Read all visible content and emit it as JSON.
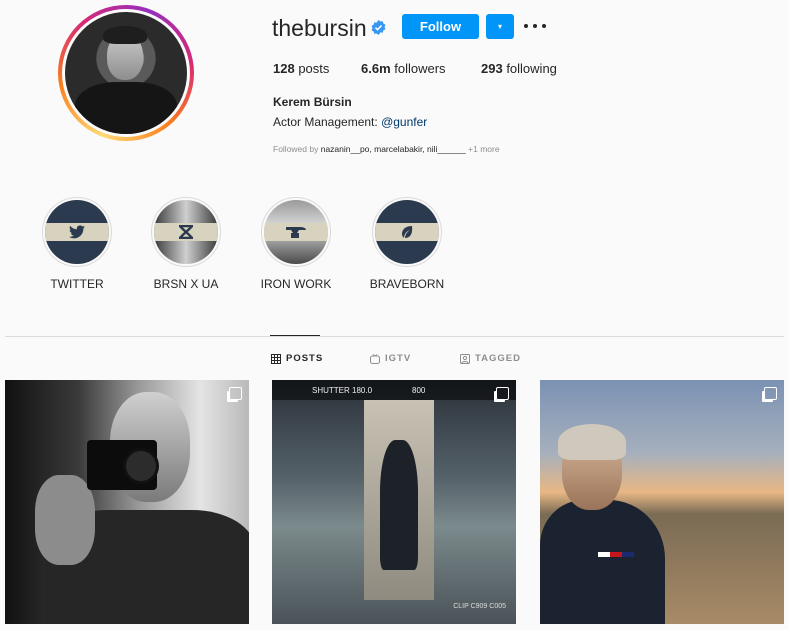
{
  "profile": {
    "username": "thebursin",
    "follow_label": "Follow",
    "dropdown_glyph": "▾",
    "posts_count": "128",
    "posts_label": " posts",
    "followers_count": "6.6m",
    "followers_label": " followers",
    "following_count": "293",
    "following_label": " following",
    "full_name": "Kerem Bürsin",
    "bio_text": "Actor Management: ",
    "bio_link": "@gunfer",
    "followed_by_prefix": "Followed by ",
    "followed_by_names": "nazanin__po, marcelabakir, nili______",
    "followed_by_more": " +1 more"
  },
  "highlights": [
    {
      "label": "TWITTER",
      "icon": "twitter-bird-icon",
      "glyph": "🐦"
    },
    {
      "label": "BRSN X UA",
      "icon": "under-armour-icon",
      "glyph": "⋈"
    },
    {
      "label": "IRON WORK",
      "icon": "anvil-icon",
      "glyph": "▰"
    },
    {
      "label": "BRAVEBORN",
      "icon": "leaf-icon",
      "glyph": "❦"
    }
  ],
  "tabs": {
    "posts": "POSTS",
    "igtv": "IGTV",
    "tagged": "TAGGED"
  },
  "posts": {
    "p2_shutter": "SHUTTER  180.0",
    "p2_iso": "800",
    "p2_clip": "CLIP C909 C005"
  },
  "colors": {
    "accent": "#0095f6",
    "link": "#00376b",
    "text": "#262626",
    "muted": "#8e8e8e",
    "background": "#fafafa"
  }
}
